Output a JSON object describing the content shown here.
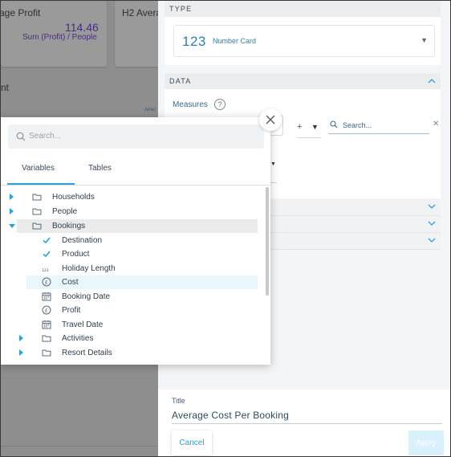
{
  "background": {
    "card1": {
      "title": "age Profit",
      "value": "114.46",
      "subtitle": "Sum (Profit) / People"
    },
    "card2": {
      "title": "H2 Avera"
    },
    "partial_text": "nt",
    "mini_label": "Amer"
  },
  "type_section": {
    "heading": "TYPE",
    "selected_icon": "123",
    "selected_label": "Number Card"
  },
  "data_section": {
    "heading": "DATA",
    "measures_label": "Measures",
    "help": "?",
    "operator": "+",
    "search_placeholder": "Search..."
  },
  "popup": {
    "search_placeholder": "Search...",
    "tabs": [
      {
        "label": "Variables",
        "active": true
      },
      {
        "label": "Tables",
        "active": false
      }
    ],
    "tree": [
      {
        "label": "Households",
        "icon": "folder-icon",
        "expander": "collapsed",
        "level": 0
      },
      {
        "label": "People",
        "icon": "folder-icon",
        "expander": "collapsed",
        "level": 0
      },
      {
        "label": "Bookings",
        "icon": "folder-icon",
        "expander": "expanded",
        "level": 0,
        "highlighted": true
      },
      {
        "label": "Destination",
        "icon": "check-icon",
        "level": 1
      },
      {
        "label": "Product",
        "icon": "check-icon",
        "level": 1
      },
      {
        "label": "Holiday Length",
        "icon": "numeric-icon",
        "level": 1
      },
      {
        "label": "Cost",
        "icon": "currency-icon",
        "level": 1,
        "selected": true
      },
      {
        "label": "Booking Date",
        "icon": "calendar-icon",
        "level": 1
      },
      {
        "label": "Profit",
        "icon": "currency-icon",
        "level": 1
      },
      {
        "label": "Travel Date",
        "icon": "calendar-icon",
        "level": 1
      },
      {
        "label": "Activities",
        "icon": "folder-icon",
        "expander": "collapsed",
        "level": 1
      },
      {
        "label": "Resort Details",
        "icon": "folder-icon",
        "expander": "collapsed",
        "level": 1
      }
    ]
  },
  "footer": {
    "title_label": "Title",
    "title_value": "Average Cost Per Booking",
    "cancel_label": "Cancel",
    "apply_label": "Apply"
  },
  "colors": {
    "accent": "#27a3d9",
    "selected_row": "#e9f6fb",
    "highlight_row": "#ebebeb",
    "value_purple": "#4b2c87"
  }
}
